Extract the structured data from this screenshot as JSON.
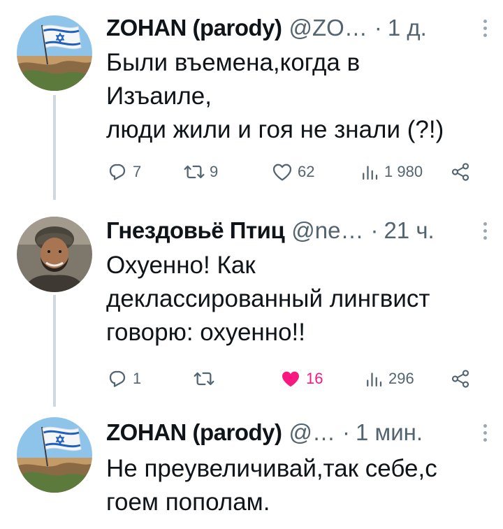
{
  "tweets": [
    {
      "name": "ZOHAN (parody)",
      "handle": "@ZO…",
      "time": "1 д.",
      "text": "Были въемена,когда в\nИзъаиле,\nлюди жили и гоя не знали (?!)",
      "avatar_icon": "israeli-flag-avatar",
      "stats": {
        "replies": "7",
        "retweets": "9",
        "likes": "62",
        "views": "1 980"
      },
      "liked": false
    },
    {
      "name": "Гнездовьё Птиц",
      "handle": "@ne…",
      "time": "21 ч.",
      "text": "Охуенно! Как\nдеклассированный лингвист\nговорю: охуенно!!",
      "avatar_icon": "bearded-man-turban-avatar",
      "stats": {
        "replies": "1",
        "retweets": "",
        "likes": "16",
        "views": "296"
      },
      "liked": true
    },
    {
      "name": "ZOHAN (parody)",
      "handle": "@…",
      "time": "1 мин.",
      "text": "Не преувеличивай,так себе,с\nгоем пополам.",
      "avatar_icon": "israeli-flag-avatar"
    }
  ],
  "colors": {
    "text": "#0f1419",
    "secondary": "#536471",
    "like": "#f91880",
    "thread": "#cfd9de"
  },
  "icons": [
    "reply-icon",
    "retweet-icon",
    "like-icon",
    "views-icon",
    "share-icon",
    "more-icon"
  ]
}
